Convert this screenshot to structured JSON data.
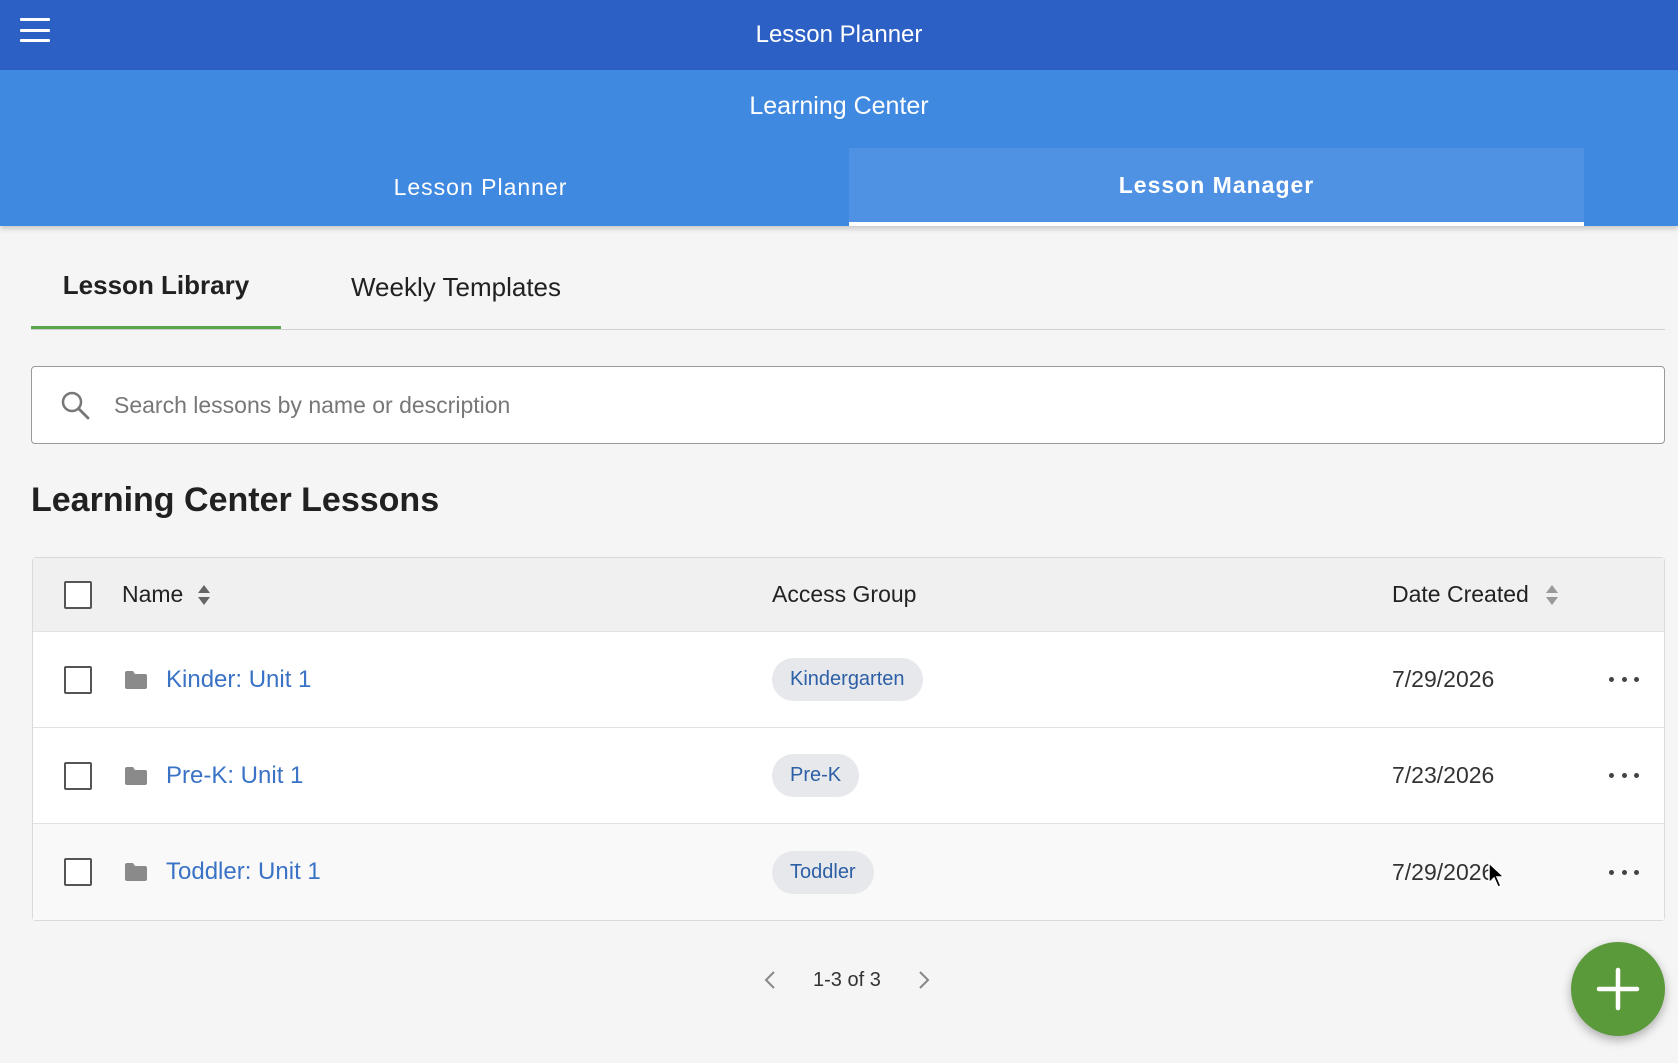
{
  "app": {
    "title": "Lesson Planner"
  },
  "header": {
    "subtitle": "Learning Center",
    "tabs": [
      {
        "label": "Lesson Planner",
        "active": false
      },
      {
        "label": "Lesson Manager",
        "active": true
      }
    ]
  },
  "subtabs": [
    {
      "label": "Lesson Library",
      "active": true
    },
    {
      "label": "Weekly Templates",
      "active": false
    }
  ],
  "search": {
    "placeholder": "Search lessons by name or description",
    "value": ""
  },
  "section": {
    "title": "Learning Center Lessons"
  },
  "table": {
    "columns": {
      "name": "Name",
      "access_group": "Access Group",
      "date_created": "Date Created"
    },
    "rows": [
      {
        "name": "Kinder: Unit 1",
        "access_group": "Kindergarten",
        "date_created": "7/29/2026"
      },
      {
        "name": "Pre-K: Unit 1",
        "access_group": "Pre-K",
        "date_created": "7/23/2026"
      },
      {
        "name": "Toddler: Unit 1",
        "access_group": "Toddler",
        "date_created": "7/29/2026"
      }
    ]
  },
  "pagination": {
    "label": "1-3 of 3"
  },
  "colors": {
    "topbar": "#2c60c4",
    "header": "#4089e0",
    "accent_green": "#5aa64a",
    "link_blue": "#3a73c6",
    "fab_green": "#5b9a3a"
  },
  "icons": [
    "menu-icon",
    "search-icon",
    "sort-icon",
    "folder-icon",
    "more-icon",
    "chevron-left-icon",
    "chevron-right-icon",
    "plus-icon"
  ]
}
